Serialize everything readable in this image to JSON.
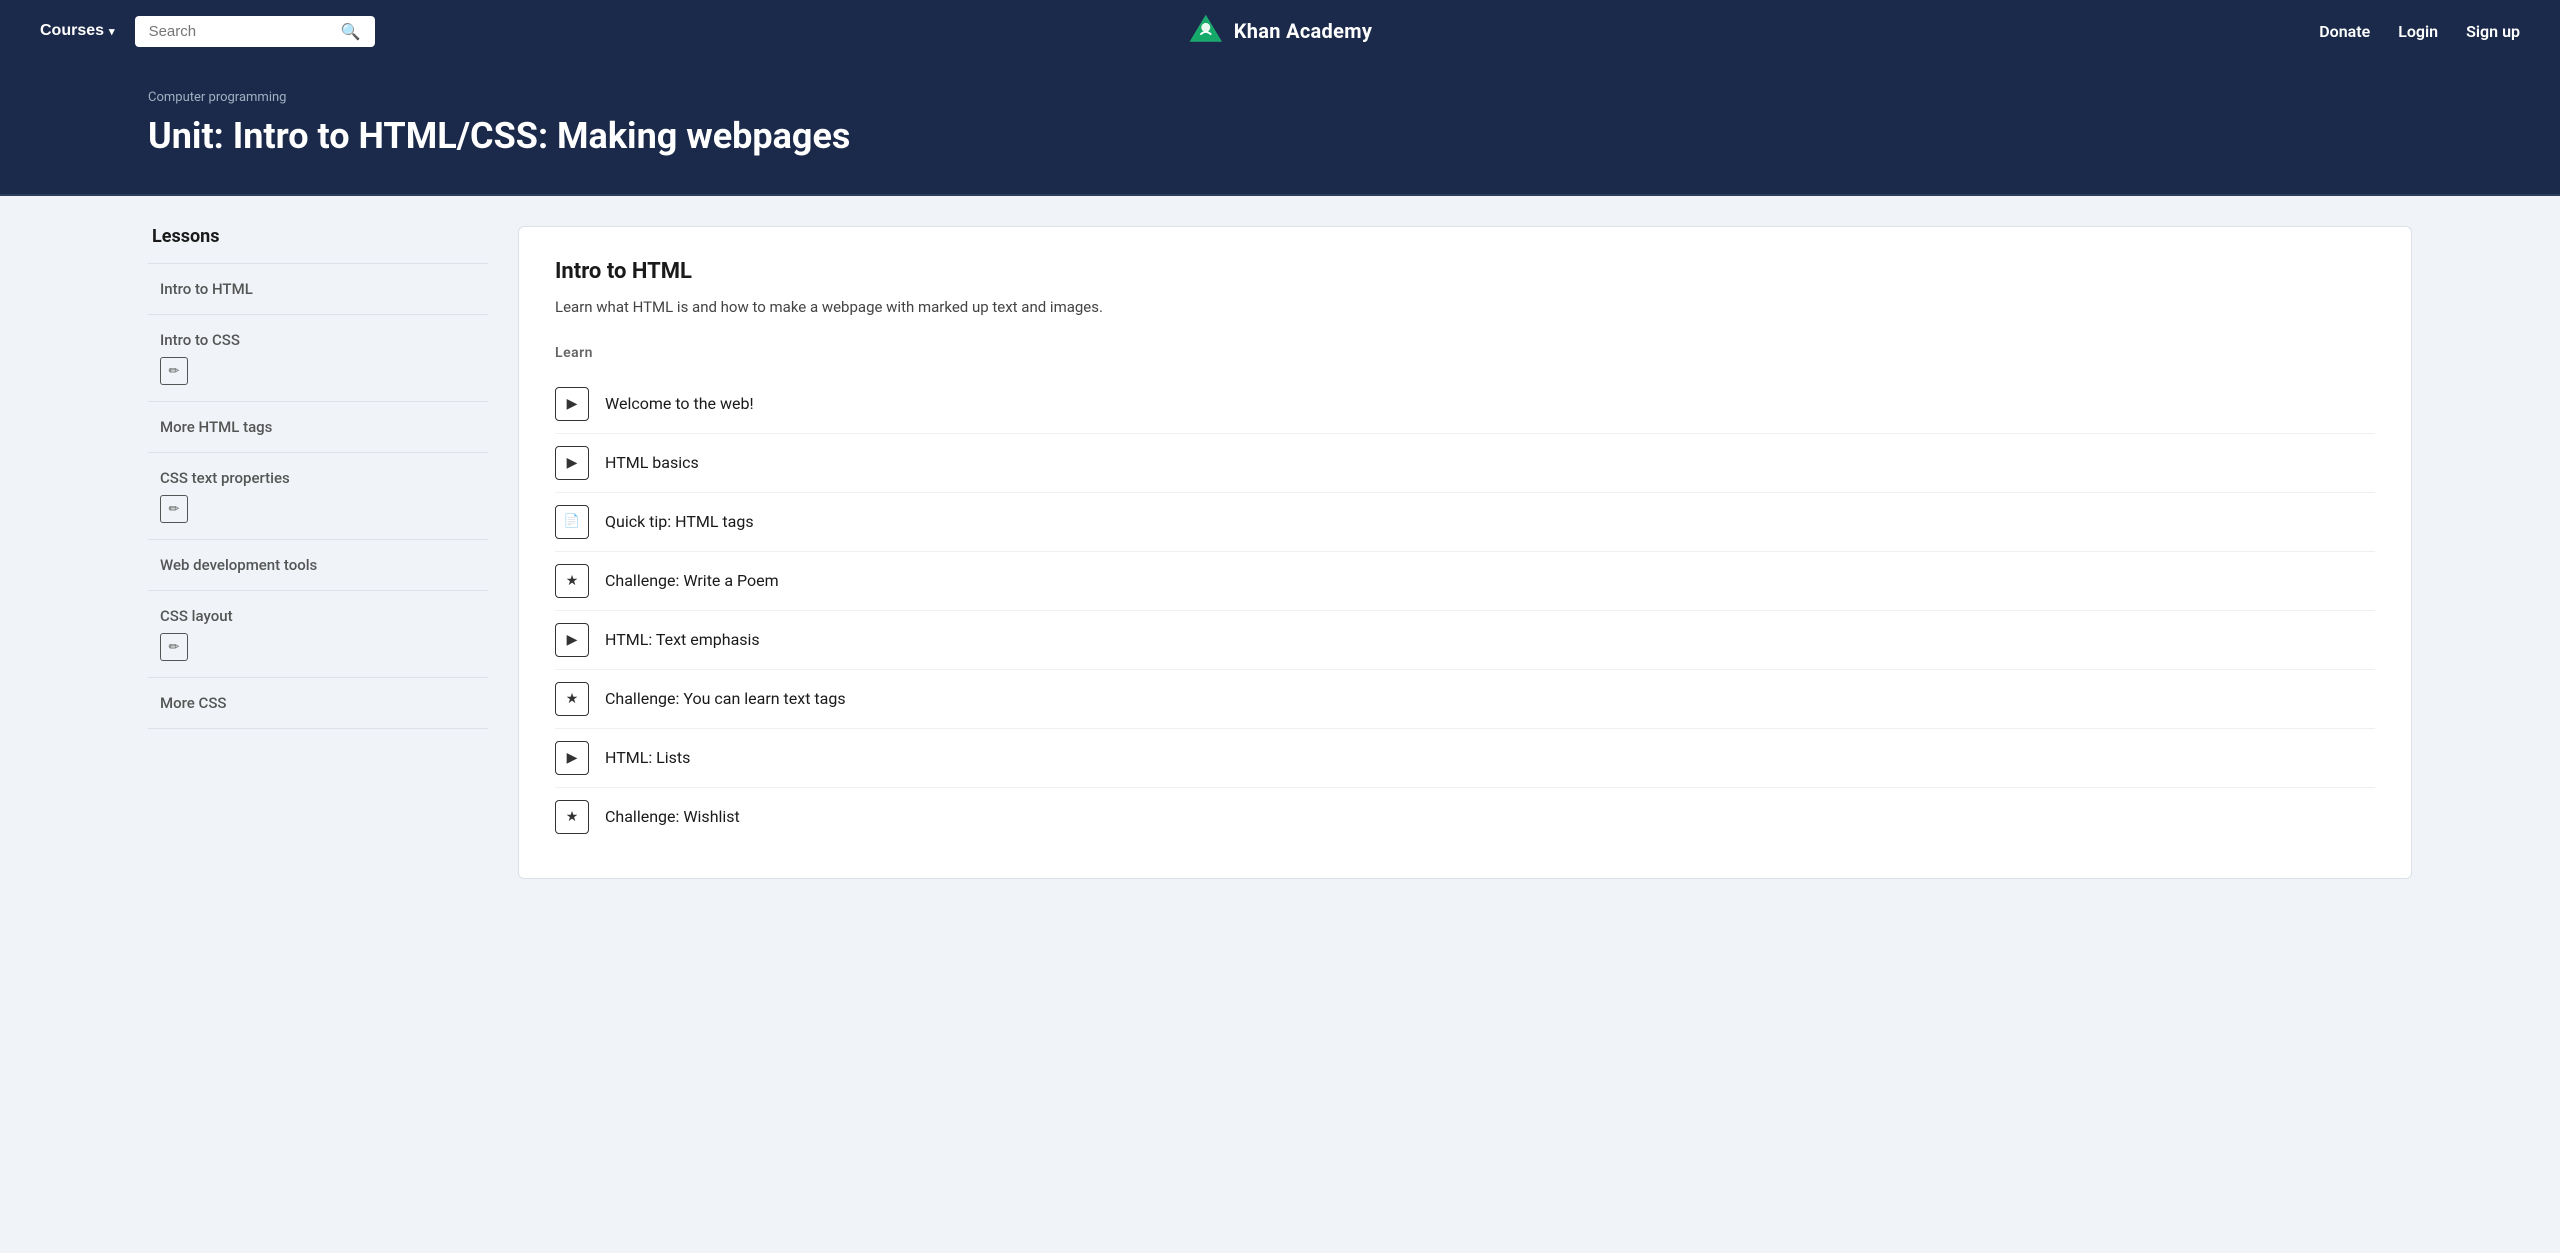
{
  "navbar": {
    "courses_label": "Courses",
    "search_placeholder": "Search",
    "brand_name": "Khan Academy",
    "donate_label": "Donate",
    "login_label": "Login",
    "signup_label": "Sign up"
  },
  "hero": {
    "breadcrumb": "Computer programming",
    "title": "Unit: Intro to HTML/CSS: Making webpages"
  },
  "sidebar": {
    "title": "Lessons",
    "items": [
      {
        "label": "Intro to HTML",
        "has_icon": false
      },
      {
        "label": "Intro to CSS",
        "has_icon": true
      },
      {
        "label": "More HTML tags",
        "has_icon": false
      },
      {
        "label": "CSS text properties",
        "has_icon": true
      },
      {
        "label": "Web development tools",
        "has_icon": false
      },
      {
        "label": "CSS layout",
        "has_icon": true
      },
      {
        "label": "More CSS",
        "has_icon": false
      }
    ]
  },
  "content": {
    "title": "Intro to HTML",
    "description": "Learn what HTML is and how to make a webpage with marked up text and images.",
    "section_label": "Learn",
    "lessons": [
      {
        "label": "Welcome to the web!",
        "type": "video"
      },
      {
        "label": "HTML basics",
        "type": "video"
      },
      {
        "label": "Quick tip: HTML tags",
        "type": "article"
      },
      {
        "label": "Challenge: Write a Poem",
        "type": "challenge"
      },
      {
        "label": "HTML: Text emphasis",
        "type": "video"
      },
      {
        "label": "Challenge: You can learn text tags",
        "type": "challenge"
      },
      {
        "label": "HTML: Lists",
        "type": "video"
      },
      {
        "label": "Challenge: Wishlist",
        "type": "challenge"
      }
    ]
  },
  "icons": {
    "search": "🔍",
    "chevron_down": "▾",
    "video": "▶",
    "article": "📄",
    "challenge": "★",
    "pencil": "✏"
  }
}
